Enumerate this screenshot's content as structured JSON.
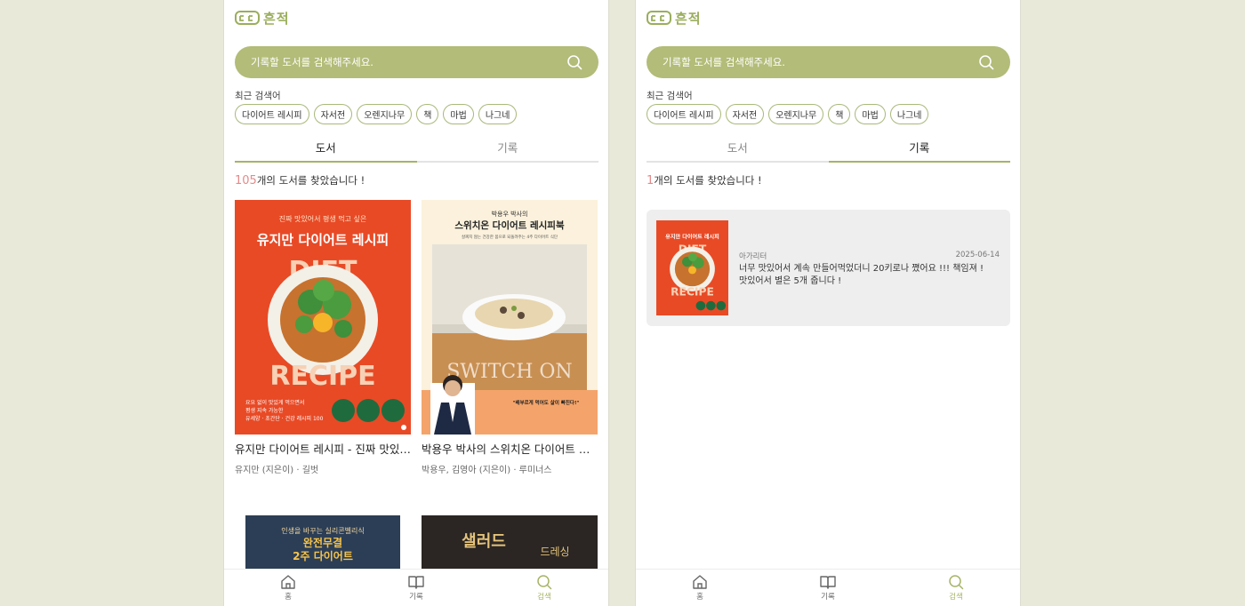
{
  "app": {
    "logo_text": "흔적"
  },
  "search": {
    "placeholder": "기록할 도서를 검색해주세요."
  },
  "recent": {
    "label": "최근 검색어",
    "chips": [
      "다이어트 레시피",
      "자서전",
      "오렌지나무",
      "책",
      "마법",
      "나그네"
    ]
  },
  "tabs": [
    "도서",
    "기록"
  ],
  "left": {
    "result_count": "105",
    "result_suffix": "개의 도서를 찾았습니다 !",
    "books": [
      {
        "title": "유지만 다이어트 레시피 - 진짜 맛있어서 평생 먹고 싶은",
        "meta": "유지만 (지은이) · 길벗",
        "cover": {
          "top_text": "진짜 맛있어서 평생 먹고 싶은",
          "headline": "유지만 다이어트 레시피",
          "diet": "DIET",
          "recipe": "RECIPE",
          "bottom_text_1": "요요 없이 맛있게 먹으면서",
          "bottom_text_2": "평생 지속 가능한",
          "bottom_text_3": "유세양 · 초간단 · 건강 레시피 100"
        }
      },
      {
        "title": "박용우 박사의 스위치온 다이어트 레시피북",
        "meta": "박용우, 김영아 (지은이) · 루미너스",
        "cover": {
          "top_text": "박용우 박사의",
          "headline": "스위치온 다이어트 레시피북",
          "sub": "살찌지 않는 건강한 몸으로 되돌려주는 4주 다이어트 식단",
          "switch_on": "SWITCH ON",
          "quote": "\"배부르게 먹어도 살이 빠진다!\""
        }
      }
    ],
    "partial_books": [
      {
        "line1": "인생을 바꾸는 실리콘벨리식",
        "line2": "완전무결",
        "line3": "2주 다이어트"
      },
      {
        "line1": "샐러드",
        "line2": "드레싱"
      }
    ]
  },
  "right": {
    "result_count": "1",
    "result_suffix": "개의 도서를 찾았습니다 !",
    "record": {
      "author": "아가리터",
      "date": "2025-06-14",
      "text_line1": "너무 맛있어서 계속 만들어먹었더니 20키로나 쪘어요 !!! 책임져 !",
      "text_line2": "맛있어서 별은 5개 줍니다 !"
    }
  },
  "nav": [
    {
      "icon": "home-icon",
      "label": "홈"
    },
    {
      "icon": "book-icon",
      "label": "기록"
    },
    {
      "icon": "search-icon",
      "label": "검색"
    }
  ],
  "colors": {
    "accent": "#b3bc78",
    "accent_dark": "#a6b467",
    "count": "#e58a8a",
    "cover_red": "#e84a26",
    "cover_cream": "#fbf1dc"
  }
}
